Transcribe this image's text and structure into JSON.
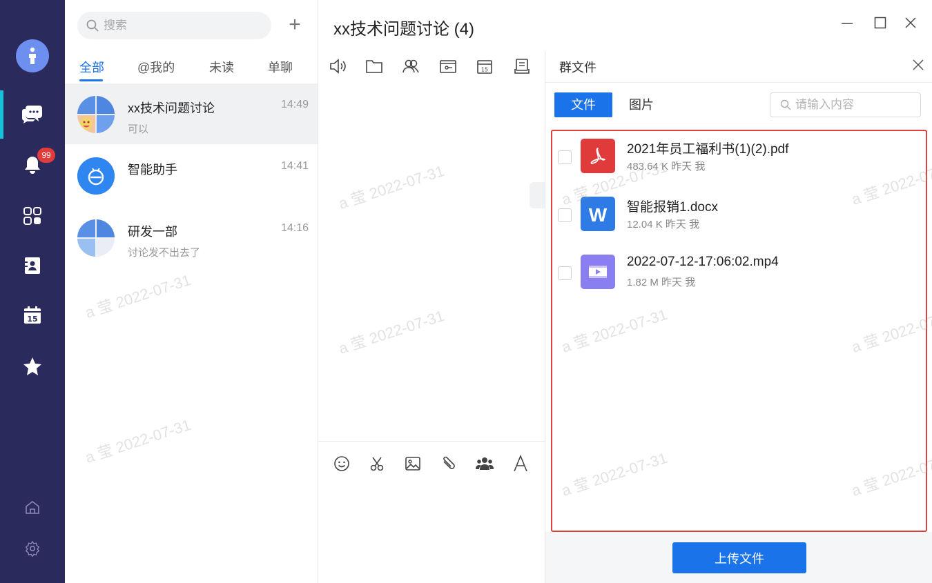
{
  "sidebar": {
    "badge_count": "99",
    "active_color": "#16c2d6",
    "bg_color": "#2b2a5c",
    "icons": [
      "user-icon",
      "chat-icon",
      "bell-icon",
      "apps-icon",
      "contacts-icon",
      "calendar-icon",
      "star-icon",
      "home-icon",
      "settings-icon"
    ]
  },
  "search": {
    "placeholder": "搜索"
  },
  "tabs": [
    {
      "label": "全部"
    },
    {
      "label": "@我的"
    },
    {
      "label": "未读"
    },
    {
      "label": "单聊"
    }
  ],
  "conversations": [
    {
      "name": "xx技术问题讨论",
      "time": "14:49",
      "preview": "可以"
    },
    {
      "name": "智能助手",
      "time": "14:41",
      "preview": ""
    },
    {
      "name": "研发一部",
      "time": "14:16",
      "preview": "讨论发不出去了"
    }
  ],
  "chat": {
    "title": "xx技术问题讨论 (4)"
  },
  "panel": {
    "title": "群文件",
    "tab_file": "文件",
    "tab_image": "图片",
    "search_placeholder": "请输入内容",
    "upload_label": "上传文件",
    "files": [
      {
        "name": "2021年员工福利书(1)(2).pdf",
        "size": "483.64 K",
        "when": "昨天",
        "owner": "我",
        "type": "pdf-icon"
      },
      {
        "name": "智能报销1.docx",
        "size": "12.04 K",
        "when": "昨天",
        "owner": "我",
        "type": "word-icon"
      },
      {
        "name": "2022-07-12-17:06:02.mp4",
        "size": "1.82 M",
        "when": "昨天",
        "owner": "我",
        "type": "video-icon"
      }
    ]
  },
  "watermark": {
    "text": "a 莹 2022-07-31"
  },
  "colors": {
    "accent": "#1a73e8",
    "danger": "#e0403c",
    "pdf": "#e03a3a",
    "word": "#2f7be6",
    "video": "#8a7ff0"
  }
}
